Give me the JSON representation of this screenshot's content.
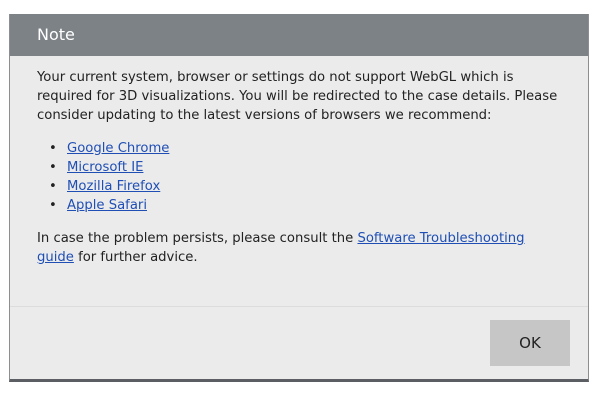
{
  "dialog": {
    "title": "Note",
    "message": "Your current system, browser or settings do not support WebGL which is required for 3D visualizations. You will be redirected to the case details. Please consider updating to the latest versions of browsers we recommend:",
    "browsers": [
      {
        "label": "Google Chrome"
      },
      {
        "label": "Microsoft IE"
      },
      {
        "label": "Mozilla Firefox"
      },
      {
        "label": "Apple Safari"
      }
    ],
    "bullet": "•",
    "footnote_prefix": "In case the problem persists, please consult the ",
    "footnote_link": "Software Troubleshooting guide",
    "footnote_suffix": " for further advice.",
    "ok_label": "OK"
  },
  "colors": {
    "titlebar": "#7d8287",
    "background": "#ebebeb",
    "link": "#1f4fb5",
    "button": "#c6c6c6"
  }
}
